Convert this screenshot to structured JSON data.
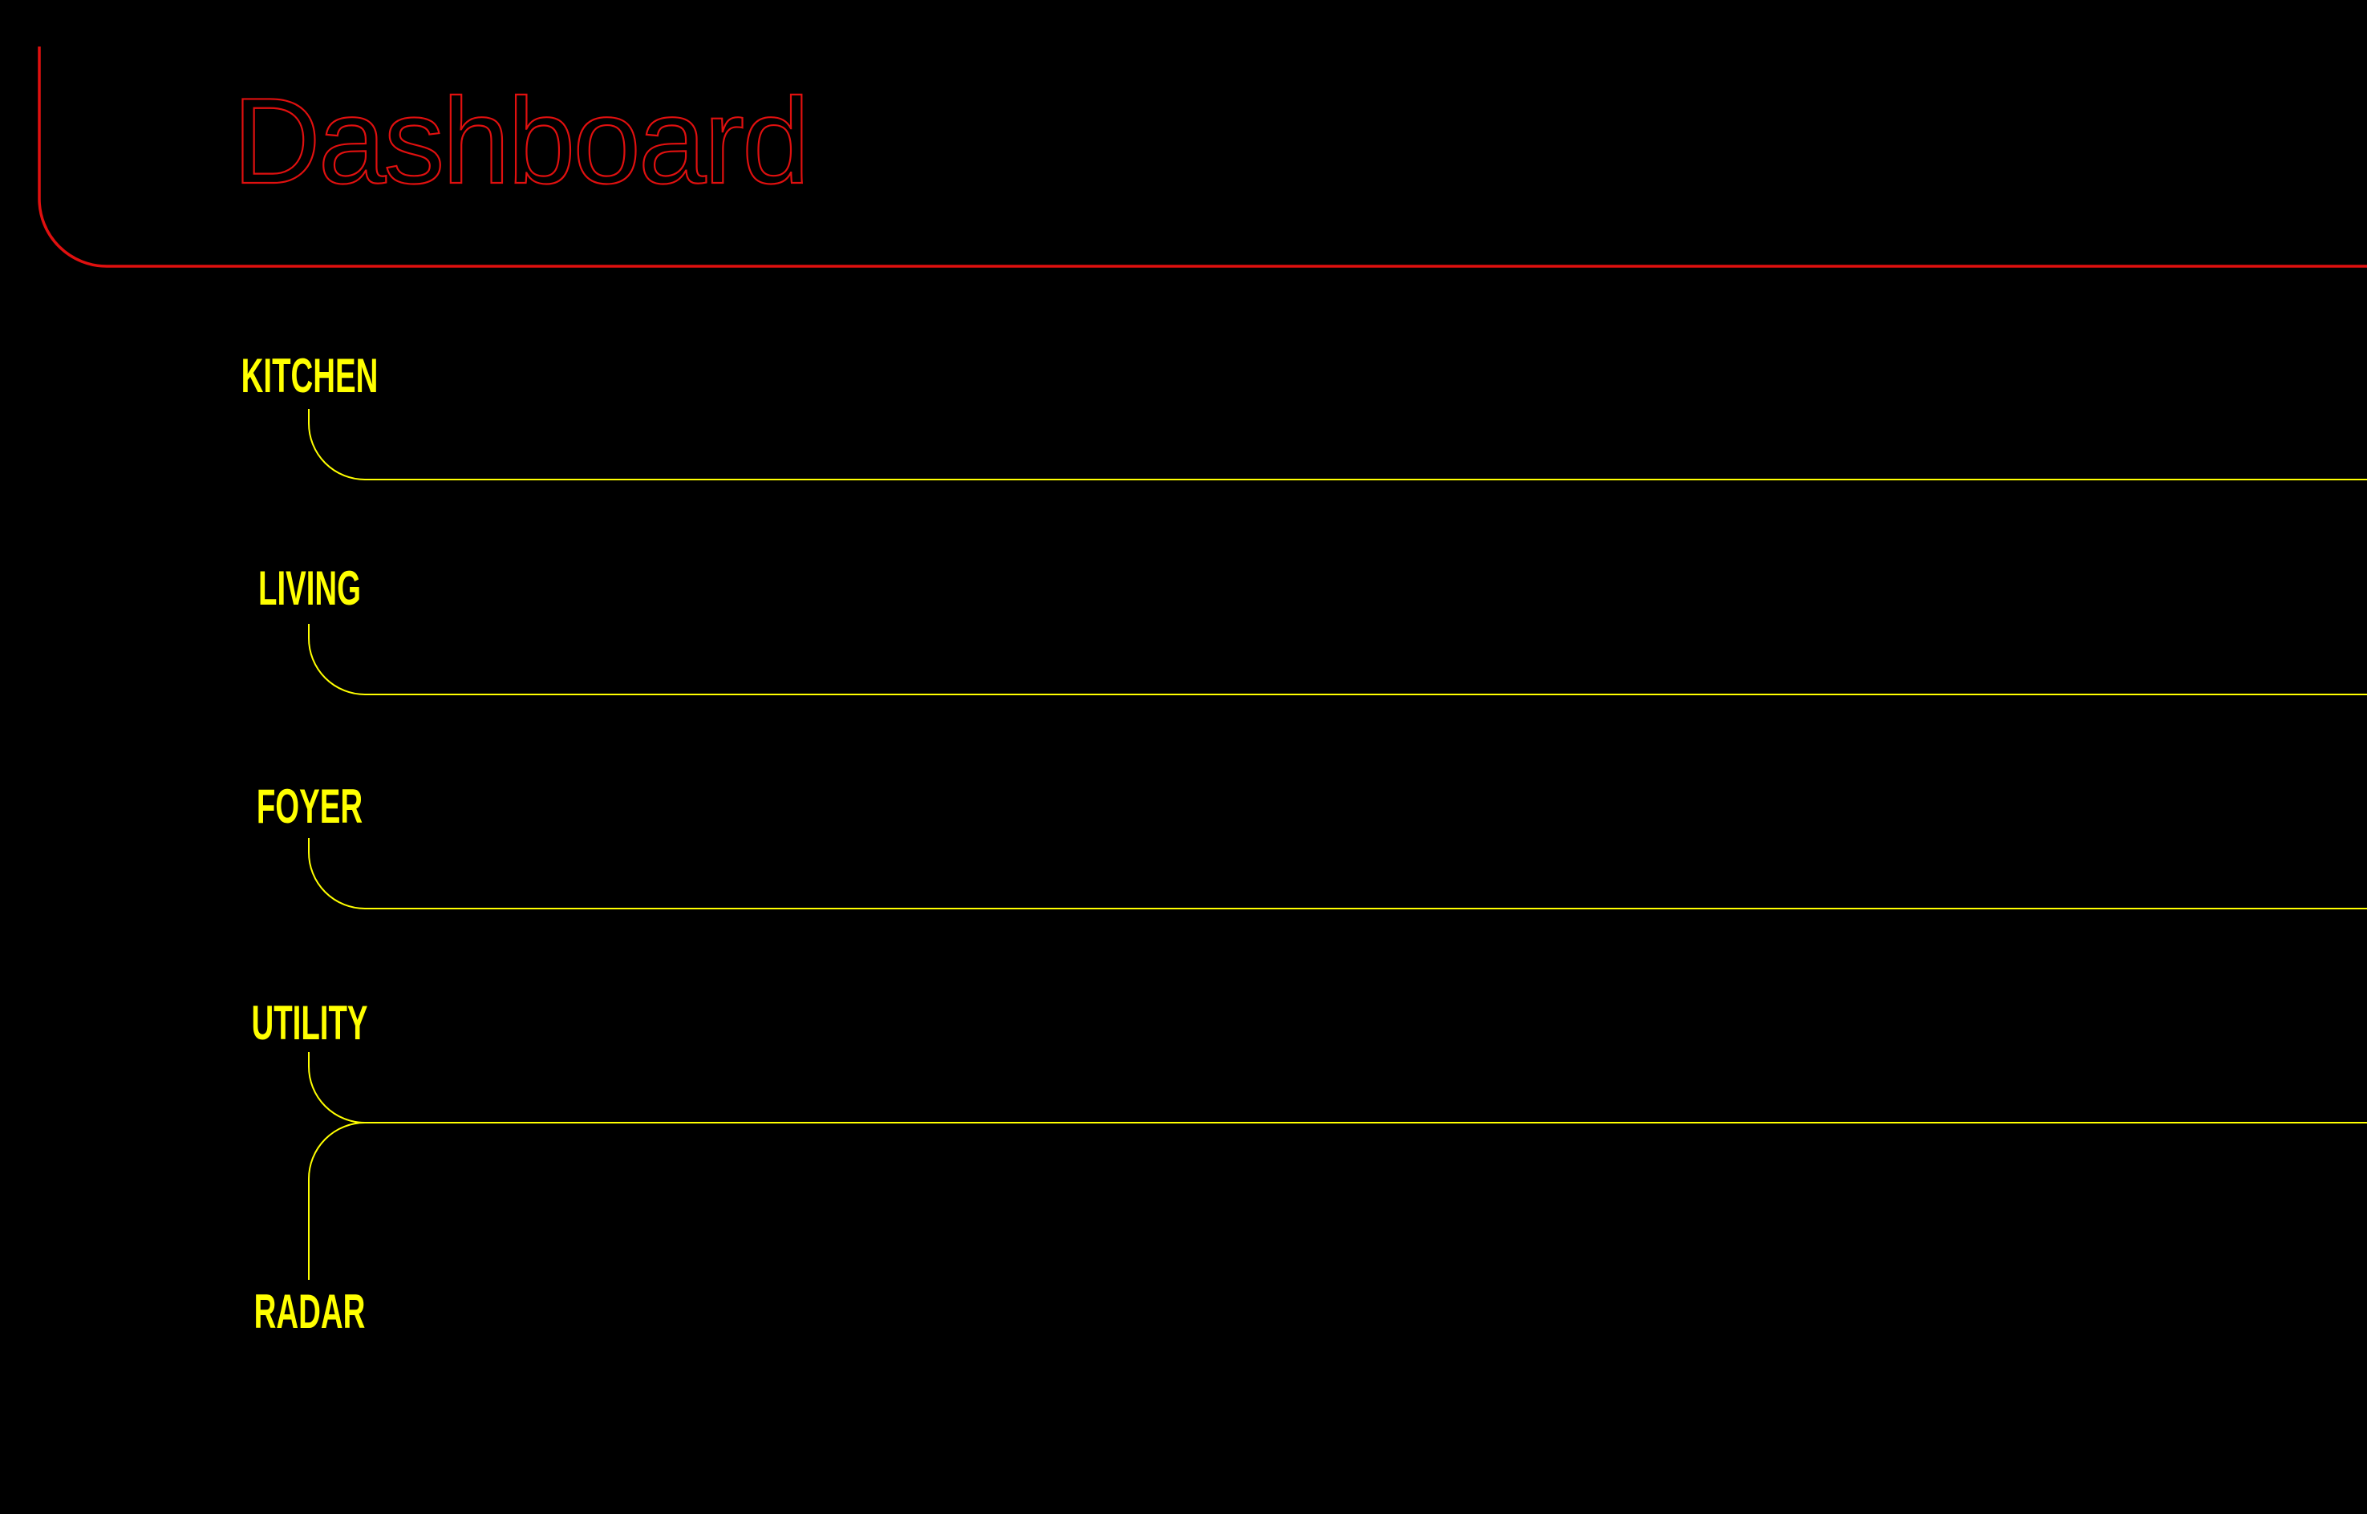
{
  "title": "Dashboard",
  "rooms": [
    {
      "label": "KITCHEN"
    },
    {
      "label": "LIVING"
    },
    {
      "label": "FOYER"
    },
    {
      "label": "UTILITY"
    },
    {
      "label": "RADAR"
    }
  ],
  "colors": {
    "background": "#000000",
    "title_accent": "#e0100f",
    "room_accent": "#ffff00"
  }
}
